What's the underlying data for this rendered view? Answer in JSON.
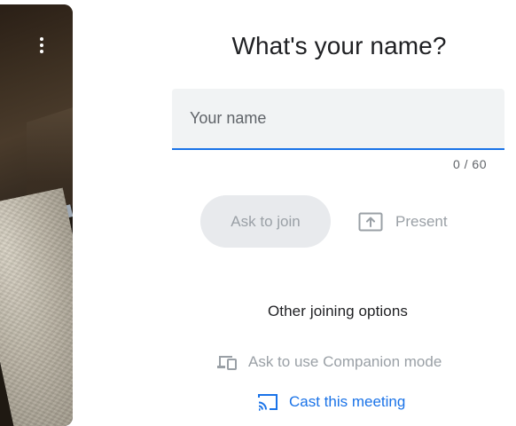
{
  "preview": {
    "more_options_icon": "more-vert-icon"
  },
  "join": {
    "title": "What's your name?",
    "name_placeholder": "Your name",
    "name_value": "",
    "char_counter": "0 / 60",
    "ask_to_join_label": "Ask to join",
    "present_label": "Present",
    "present_icon": "present-to-all-icon"
  },
  "other": {
    "heading": "Other joining options",
    "companion_label": "Ask to use Companion mode",
    "companion_icon": "devices-icon",
    "cast_label": "Cast this meeting",
    "cast_icon": "cast-icon"
  },
  "colors": {
    "accent": "#1a73e8",
    "disabled_text": "#9aa0a6",
    "field_bg": "#f1f3f4",
    "button_disabled_bg": "#e8eaed"
  }
}
